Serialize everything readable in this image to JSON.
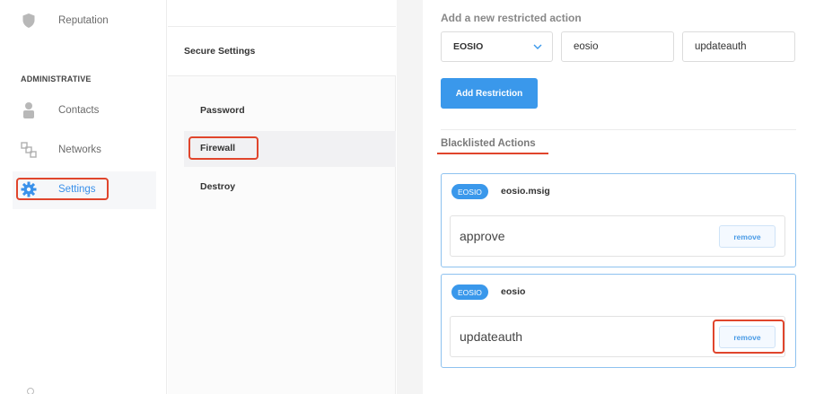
{
  "sidebar": {
    "items": [
      {
        "label": "Reputation",
        "icon": "shield-icon"
      },
      {
        "label": "Contacts",
        "icon": "person-icon"
      },
      {
        "label": "Networks",
        "icon": "network-icon"
      },
      {
        "label": "Settings",
        "icon": "gear-icon"
      }
    ],
    "section_label": "ADMINISTRATIVE",
    "active": "Settings"
  },
  "middle": {
    "header": "Secure Settings",
    "menu": [
      "Password",
      "Firewall",
      "Destroy"
    ],
    "active": "Firewall"
  },
  "content": {
    "add_title": "Add a new restricted action",
    "blockchain_select": "EOSIO",
    "contract_field": "eosio",
    "action_field": "updateauth",
    "add_button": "Add Restriction",
    "blacklisted_title": "Blacklisted Actions",
    "blacklisted": [
      {
        "badge": "EOSIO",
        "contract": "eosio.msig",
        "action": "approve",
        "remove_label": "remove"
      },
      {
        "badge": "EOSIO",
        "contract": "eosio",
        "action": "updateauth",
        "remove_label": "remove"
      }
    ]
  },
  "colors": {
    "accent": "#3a98eb",
    "highlight": "#e0452c"
  }
}
